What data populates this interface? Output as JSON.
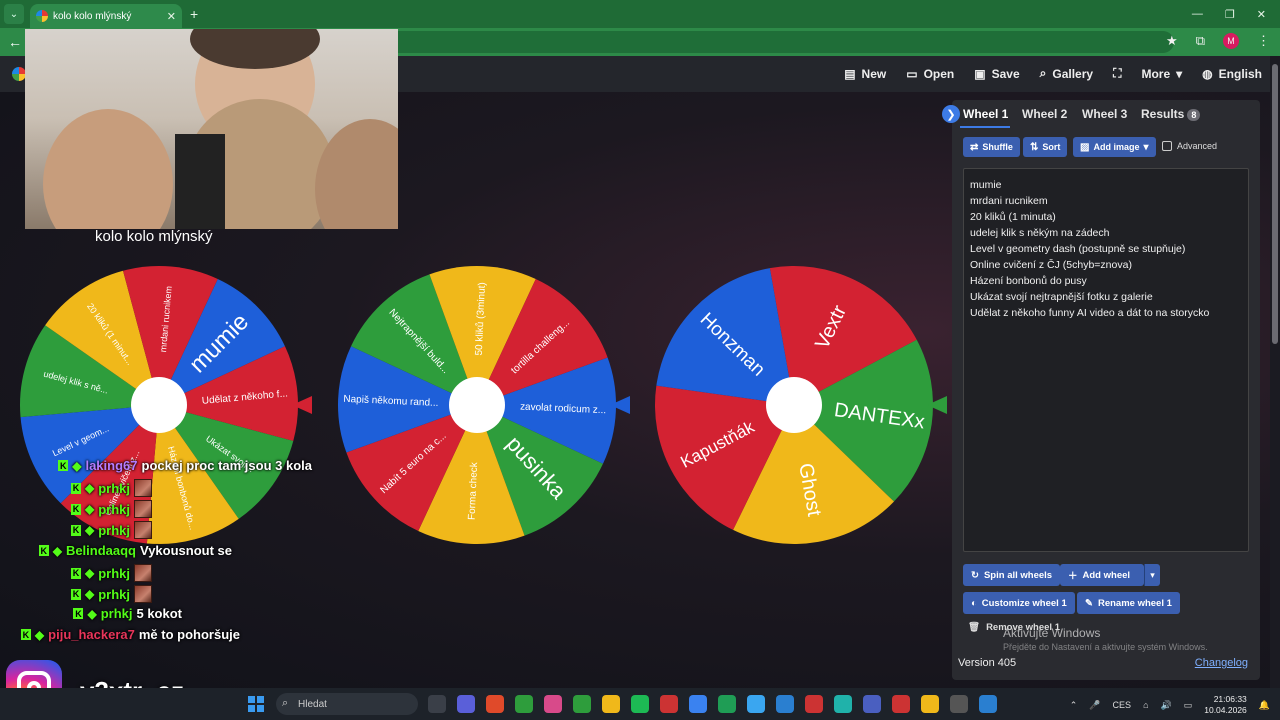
{
  "browser": {
    "tab_title": "kolo kolo mlýnský",
    "new_tab": "+",
    "close": "✕",
    "back": "←",
    "avatar": "M"
  },
  "app_menu": {
    "new": "New",
    "open": "Open",
    "save": "Save",
    "gallery": "Gallery",
    "more": "More",
    "language": "English"
  },
  "stream_title": "kolo kolo mlýnský",
  "wheels": [
    {
      "labels": [
        "mumie",
        "Udělat z někoho f...",
        "Ukázat svojí...",
        "Házení bonbonů do...",
        "Online cvičení z...",
        "Level v geom...",
        "udelej klik s ně...",
        "20 kliků (1 minut...",
        "mrdani rucnikem"
      ],
      "colors": [
        "#1e5fd9",
        "#d32232",
        "#2e9d3c",
        "#f0b81a",
        "#d32232",
        "#1e5fd9",
        "#2e9d3c",
        "#f0b81a",
        "#d32232"
      ]
    },
    {
      "labels": [
        "zavolat rodicum z...",
        "pusinka",
        "Forma check",
        "Nabít 5 euro na c...",
        "Napiš někomu rand...",
        "Nejtrapnější buld...",
        "50 kliků (3minut)",
        "tortilla challeng..."
      ],
      "colors": [
        "#1e5fd9",
        "#2e9d3c",
        "#f0b81a",
        "#d32232",
        "#1e5fd9",
        "#2e9d3c",
        "#f0b81a",
        "#d32232"
      ]
    },
    {
      "labels": [
        "Vextr",
        "DANTEXx",
        "Ghost",
        "Kapustňák",
        "Honzman"
      ],
      "colors": [
        "#d32232",
        "#2e9d3c",
        "#f0b81a",
        "#d32232",
        "#1e5fd9"
      ]
    }
  ],
  "chat": [
    {
      "user": "laking67",
      "color": "#b57cff",
      "message": "pockej proc tam jsou 3 kola"
    },
    {
      "user": "prhkj",
      "color": "#53fc18",
      "message": "",
      "emote": true
    },
    {
      "user": "prhkj",
      "color": "#53fc18",
      "message": "",
      "emote": true
    },
    {
      "user": "prhkj",
      "color": "#53fc18",
      "message": "",
      "emote": true
    },
    {
      "user": "Belindaaqq",
      "color": "#53fc18",
      "message": "Vykousnout se"
    },
    {
      "user": "prhkj",
      "color": "#53fc18",
      "message": "",
      "emote": true
    },
    {
      "user": "prhkj",
      "color": "#53fc18",
      "message": "",
      "emote": true
    },
    {
      "user": "prhkj",
      "color": "#53fc18",
      "message": "5 kokot"
    },
    {
      "user": "piju_hackera7",
      "color": "#e8355a",
      "message": "mě to pohoršuje"
    }
  ],
  "social_handle": "v3xtr_cz",
  "panel": {
    "tabs": [
      "Wheel 1",
      "Wheel 2",
      "Wheel 3",
      "Results"
    ],
    "results_count": "8",
    "shuffle": "Shuffle",
    "sort": "Sort",
    "add_image": "Add image",
    "advanced": "Advanced",
    "entries": [
      "mumie",
      "mrdani rucnikem",
      "20 kliků (1 minuta)",
      "udelej klik s někým na zádech",
      "Level v geometry dash (postupně se stupňuje)",
      "Online cvičení z ČJ (5chyb=znova)",
      "Házení bonbonů do pusy",
      "Ukázat svojí nejtrapnější fotku z galerie",
      "Udělat z někoho funny AI video a dát to na storycko"
    ],
    "spin_all": "Spin all wheels",
    "add_wheel": "Add wheel",
    "customize": "Customize wheel 1",
    "rename": "Rename wheel 1",
    "remove": "Remove wheel 1",
    "version": "Version 405",
    "changelog": "Changelog"
  },
  "windows_activation": {
    "title": "Aktivujte Windows",
    "subtitle": "Přejděte do Nastavení a aktivujte systém Windows."
  },
  "taskbar": {
    "search": "Hledat",
    "lang": "CES",
    "time": "21:06:33",
    "date": "10.04.2026"
  }
}
